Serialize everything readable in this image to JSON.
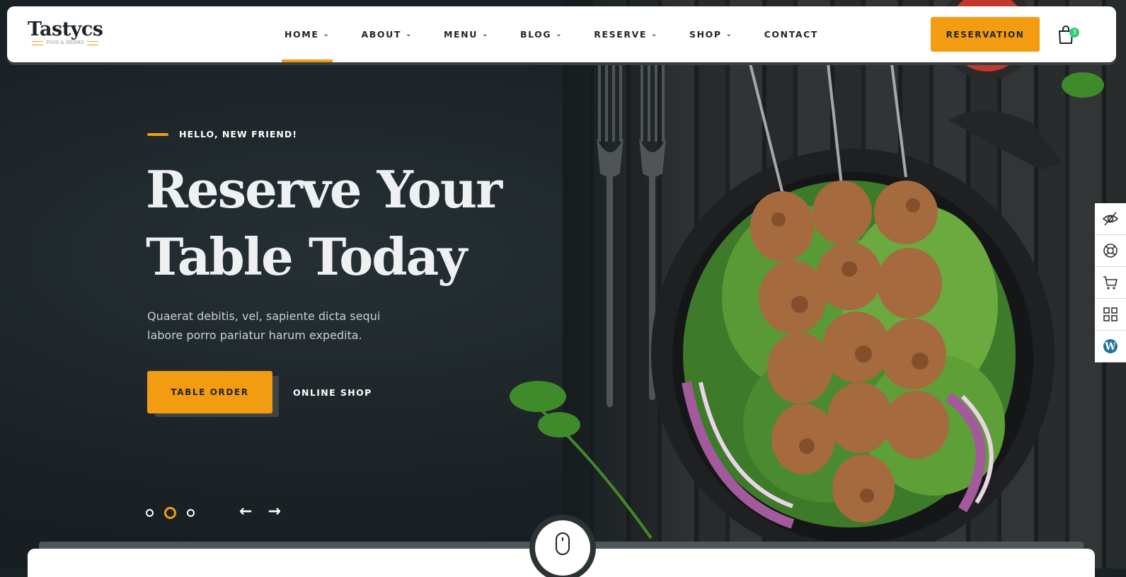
{
  "brand": {
    "name": "Tastycs",
    "tagline": "FOOD & DRINKS",
    "accent": "#f39c12",
    "dark": "#1e2529"
  },
  "nav": {
    "items": [
      {
        "label": "HOME",
        "dropdown": true,
        "active": true
      },
      {
        "label": "ABOUT",
        "dropdown": true
      },
      {
        "label": "MENU",
        "dropdown": true
      },
      {
        "label": "BLOG",
        "dropdown": true
      },
      {
        "label": "RESERVE",
        "dropdown": true
      },
      {
        "label": "SHOP",
        "dropdown": true
      },
      {
        "label": "CONTACT",
        "dropdown": false
      }
    ],
    "reservation_label": "RESERVATION",
    "cart_count": "3",
    "cart_badge_color": "#2ecc71"
  },
  "hero": {
    "kicker": "HELLO, NEW FRIEND!",
    "title_line1": "Reserve Your",
    "title_line2": "Table Today",
    "description_line1": "Quaerat debitis, vel, sapiente dicta sequi",
    "description_line2": "labore porro pariatur harum expedita.",
    "primary_button": "TABLE ORDER",
    "secondary_button": "ONLINE SHOP",
    "slides_total": 3,
    "active_slide": 2
  },
  "side_tools": [
    "eye-slash-icon",
    "lifebuoy-icon",
    "cart-icon",
    "grid-icon",
    "wordpress-icon"
  ]
}
